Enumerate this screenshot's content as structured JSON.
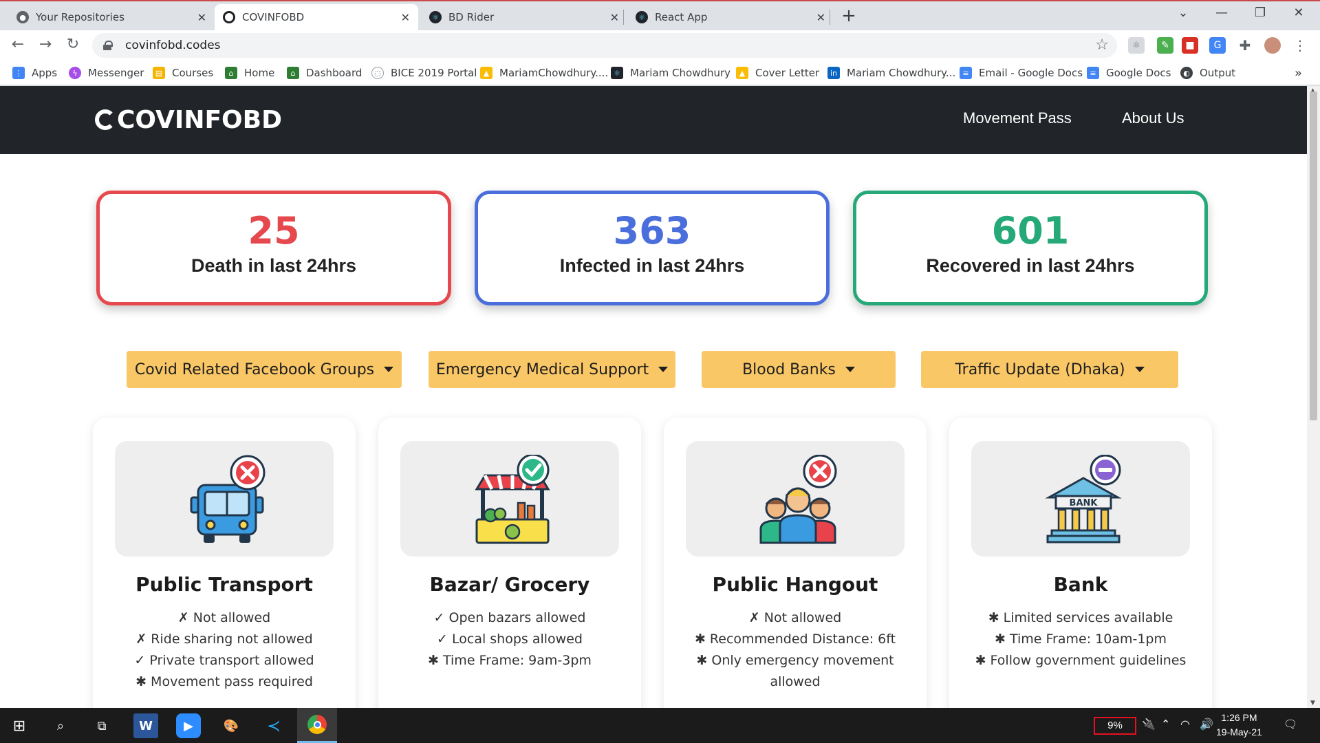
{
  "tabs": [
    {
      "title": "Your Repositories",
      "icon": "github-icon",
      "active": false
    },
    {
      "title": "COVINFOBD",
      "icon": "covinfobd-icon",
      "active": true
    },
    {
      "title": "BD Rider",
      "icon": "react-icon",
      "active": false
    },
    {
      "title": "React App",
      "icon": "react-icon",
      "active": false
    }
  ],
  "address": {
    "url": "covinfobd.codes"
  },
  "bookmarks": [
    {
      "label": "Apps",
      "icon": "apps-grid-icon"
    },
    {
      "label": "Messenger",
      "icon": "messenger-icon"
    },
    {
      "label": "Courses",
      "icon": "courses-icon"
    },
    {
      "label": "Home",
      "icon": "home-icon"
    },
    {
      "label": "Dashboard",
      "icon": "dashboard-icon"
    },
    {
      "label": "BICE 2019 Portal",
      "icon": "portal-icon"
    },
    {
      "label": "MariamChowdhury....",
      "icon": "google-drive-icon"
    },
    {
      "label": "Mariam Chowdhury",
      "icon": "react-icon"
    },
    {
      "label": "Cover Letter",
      "icon": "google-drive-icon"
    },
    {
      "label": "Mariam Chowdhury...",
      "icon": "linkedin-icon"
    },
    {
      "label": "Email - Google Docs",
      "icon": "google-docs-icon"
    },
    {
      "label": "Google Docs",
      "icon": "google-docs-icon"
    },
    {
      "label": "Output",
      "icon": "globe-icon"
    }
  ],
  "site": {
    "logo": "COVINFOBD",
    "nav": [
      {
        "label": "Movement Pass"
      },
      {
        "label": "About Us"
      }
    ],
    "stats": [
      {
        "value": "25",
        "label": "Death in last 24hrs",
        "color": "#e5484d"
      },
      {
        "value": "363",
        "label": "Infected in last 24hrs",
        "color": "#4a6fdc"
      },
      {
        "value": "601",
        "label": "Recovered in last 24hrs",
        "color": "#26a979"
      }
    ],
    "dropdowns": [
      {
        "label": "Covid Related Facebook Groups"
      },
      {
        "label": "Emergency Medical Support"
      },
      {
        "label": "Blood Banks"
      },
      {
        "label": "Traffic Update (Dhaka)"
      }
    ],
    "cards": [
      {
        "title": "Public Transport",
        "icon": "bus-icon",
        "status_icon": "not-allowed-icon",
        "items": [
          "✗ Not allowed",
          "✗ Ride sharing not allowed",
          "✓ Private transport allowed",
          "✱ Movement pass required"
        ]
      },
      {
        "title": "Bazar/ Grocery",
        "icon": "market-stall-icon",
        "status_icon": "allowed-icon",
        "items": [
          "✓ Open bazars allowed",
          "✓ Local shops allowed",
          "✱ Time Frame: 9am-3pm"
        ]
      },
      {
        "title": "Public Hangout",
        "icon": "crowd-icon",
        "status_icon": "not-allowed-icon",
        "items": [
          "✗ Not allowed",
          "✱ Recommended Distance: 6ft",
          "✱ Only emergency movement allowed"
        ]
      },
      {
        "title": "Bank",
        "icon": "bank-icon",
        "status_icon": "limited-icon",
        "bank_sign": "BANK",
        "items": [
          "✱ Limited services available",
          "✱ Time Frame: 10am-1pm",
          "✱ Follow government guidelines"
        ]
      }
    ]
  },
  "taskbar": {
    "battery": "9%",
    "time": "1:26 PM",
    "date": "19-May-21"
  },
  "colors": {
    "navbar": "#212529",
    "dropdown": "#f9c766",
    "deny": "#e8434b",
    "allow": "#2eb88a",
    "limited": "#8a63d2"
  }
}
